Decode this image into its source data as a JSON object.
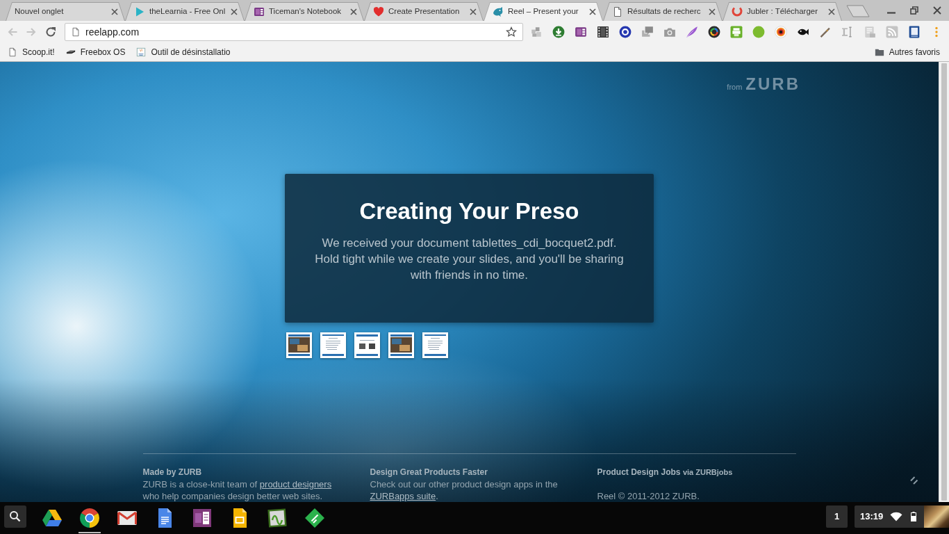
{
  "browser": {
    "tabs": [
      {
        "title": "Nouvel onglet",
        "selected": false
      },
      {
        "title": "theLearnia - Free Onl",
        "selected": false
      },
      {
        "title": "Ticeman's Notebook",
        "selected": false
      },
      {
        "title": "Create Presentation",
        "selected": false
      },
      {
        "title": "Reel – Present your",
        "selected": true
      },
      {
        "title": "Résultats de recherc",
        "selected": false
      },
      {
        "title": "Jubler : Télécharger",
        "selected": false
      }
    ],
    "nav_buttons": [
      {
        "kind": "back",
        "disabled": true
      },
      {
        "kind": "forward",
        "disabled": true
      },
      {
        "kind": "reload",
        "disabled": false
      }
    ],
    "address": "reelapp.com",
    "bookmarks": [
      {
        "label": "Scoop.it!"
      },
      {
        "label": "Freebox OS"
      },
      {
        "label": "Outil de désinstallatio"
      }
    ],
    "other_bookmarks": "Autres favoris"
  },
  "page": {
    "brand": {
      "prefix": "from",
      "name": "ZURB"
    },
    "dialog": {
      "title": "Creating Your Preso",
      "message": "We received your document tablettes_cdi_bocquet2.pdf. Hold tight while we create your slides, and you'll be sharing with friends in no time."
    },
    "thumbnails": [
      {
        "kind": "photo"
      },
      {
        "kind": "text"
      },
      {
        "kind": "images"
      },
      {
        "kind": "photo"
      },
      {
        "kind": "text"
      }
    ],
    "footer": {
      "columns": [
        {
          "heading": "Made by ZURB",
          "text": "ZURB is a close-knit team of ",
          "link": "product designers",
          "text_after": " who help companies design better web sites."
        },
        {
          "heading": "Design Great Products Faster",
          "text": "Check out our other product design apps in the ",
          "link": "ZURBapps suite",
          "text_after": "."
        },
        {
          "heading": "Product Design Jobs",
          "heading_note": "via ZURBjobs",
          "copyright": "Reel © 2011-2012 ZURB."
        }
      ]
    }
  },
  "taskbar": {
    "apps": [
      {
        "running": false
      },
      {
        "running": true
      },
      {
        "running": false
      },
      {
        "running": false
      },
      {
        "running": false
      },
      {
        "running": false
      },
      {
        "running": false
      },
      {
        "running": false
      }
    ],
    "notifications": "1",
    "time": "13:19"
  }
}
